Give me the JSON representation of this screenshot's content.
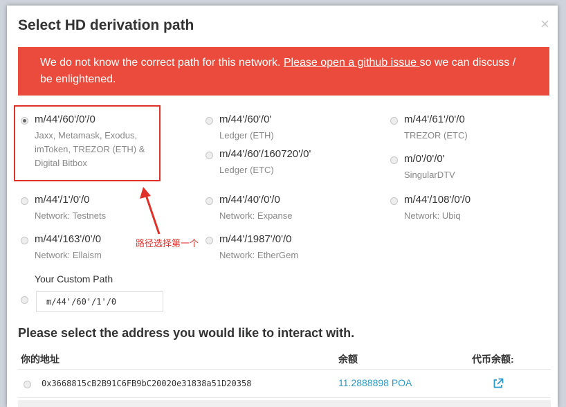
{
  "modal": {
    "title": "Select HD derivation path",
    "close": "×"
  },
  "alert": {
    "text_before": "We do not know the correct path for this network. ",
    "link": "Please open a github issue ",
    "text_after": "so we can discuss / be enlightened."
  },
  "paths": [
    {
      "path": "m/44'/60'/0'/0",
      "desc": "Jaxx, Metamask, Exodus, imToken, TREZOR (ETH) & Digital Bitbox",
      "checked": true
    },
    {
      "path": "m/44'/60'/0'",
      "desc": "Ledger (ETH)",
      "checked": false
    },
    {
      "path": "m/44'/61'/0'/0",
      "desc": "TREZOR (ETC)",
      "checked": false
    },
    {
      "path": "m/44'/60'/160720'/0'",
      "desc": "Ledger (ETC)",
      "checked": false
    },
    {
      "path": "m/0'/0'/0'",
      "desc": "SingularDTV",
      "checked": false
    },
    {
      "path": "m/44'/1'/0'/0",
      "desc": "Network: Testnets",
      "checked": false
    },
    {
      "path": "m/44'/40'/0'/0",
      "desc": "Network: Expanse",
      "checked": false
    },
    {
      "path": "m/44'/108'/0'/0",
      "desc": "Network: Ubiq",
      "checked": false
    },
    {
      "path": "m/44'/163'/0'/0",
      "desc": "Network: Ellaism",
      "checked": false
    },
    {
      "path": "m/44'/1987'/0'/0",
      "desc": "Network: EtherGem",
      "checked": false
    }
  ],
  "annotation": "路径选择第一个",
  "custom": {
    "label": "Your Custom Path",
    "value": "m/44'/60'/1'/0"
  },
  "address_section": {
    "title": "Please select the address you would like to interact with.",
    "headers": {
      "address": "你的地址",
      "balance": "余额",
      "token_balance": "代币余额:"
    },
    "rows": [
      {
        "address": "0x3668815cB2B91C6FB9bC20020e31838a51D20358",
        "balance": "11.2888898 POA"
      }
    ]
  },
  "colors": {
    "alert": "#ea4b3c",
    "link": "#2b9bc9",
    "highlight": "#e0302a"
  },
  "icons": {
    "external_link": "external-link-icon"
  }
}
